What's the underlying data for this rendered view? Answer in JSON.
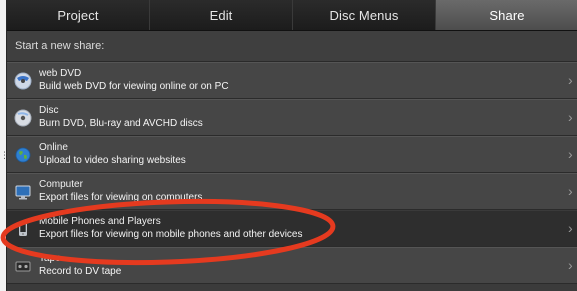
{
  "tabs": [
    {
      "label": "Project",
      "active": false
    },
    {
      "label": "Edit",
      "active": false
    },
    {
      "label": "Disc Menus",
      "active": false
    },
    {
      "label": "Share",
      "active": true
    }
  ],
  "share_heading": "Start a new share:",
  "items": [
    {
      "title": "web DVD",
      "desc": "Build web DVD for viewing online or on PC",
      "icon": "web-dvd-icon"
    },
    {
      "title": "Disc",
      "desc": "Burn DVD, Blu-ray and AVCHD discs",
      "icon": "disc-icon"
    },
    {
      "title": "Online",
      "desc": "Upload to video sharing websites",
      "icon": "globe-icon"
    },
    {
      "title": "Computer",
      "desc": "Export files for viewing on computers",
      "icon": "computer-icon"
    },
    {
      "title": "Mobile Phones and Players",
      "desc": "Export files for viewing on mobile phones and other devices",
      "icon": "mobile-phone-icon",
      "selected": true
    },
    {
      "title": "Tape",
      "desc": "Record to DV tape",
      "icon": "tape-icon"
    }
  ],
  "chevron": "›",
  "colors": {
    "panel_bg": "#3b3b3b",
    "tab_bg": "#1c1c1c",
    "tab_active_bg": "#5a5a5a",
    "highlight_ellipse": "#e53a1f"
  }
}
